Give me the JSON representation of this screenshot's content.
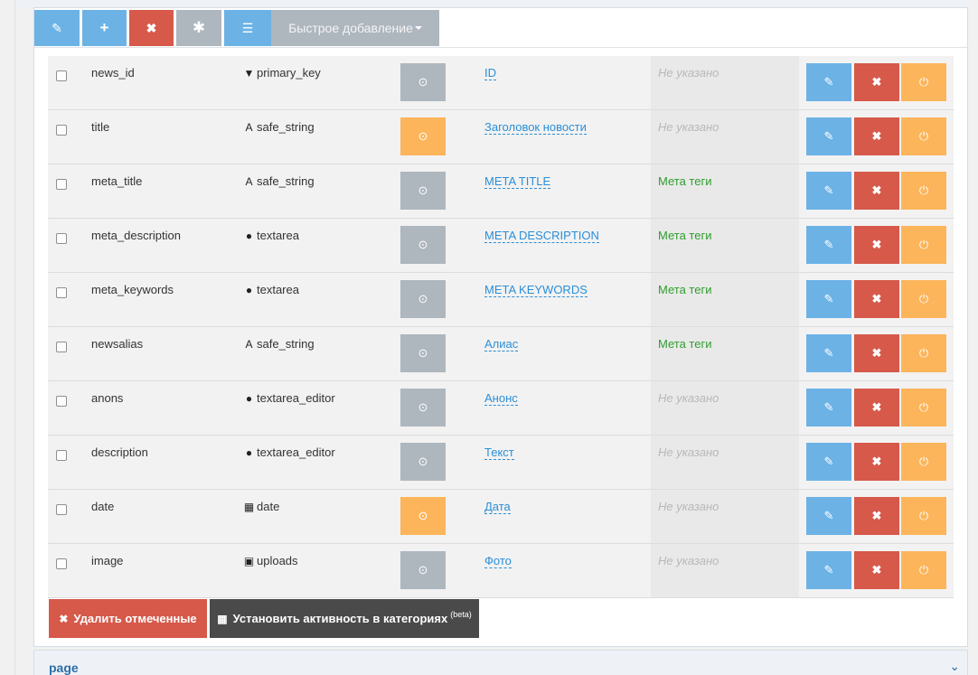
{
  "toolbar": {
    "edit_icon": "pencil-icon",
    "add_icon": "plus-icon",
    "delete_icon": "cross-icon",
    "star_icon": "asterisk-icon",
    "list_icon": "list-icon",
    "quick_add_label": "Быстрое добавление",
    "colors": {
      "primary": "#6cb2e5",
      "danger": "#d6594a",
      "muted": "#aeb6be",
      "warning": "#fcb55a",
      "dark": "#4a4a4a"
    }
  },
  "fields": [
    {
      "name": "news_id",
      "type_icon": "filter-icon",
      "type": "primary_key",
      "status": "on",
      "title": "ID",
      "category": "Не указано",
      "category_kind": "none"
    },
    {
      "name": "title",
      "type_icon": "font-icon",
      "type": "safe_string",
      "status": "warn",
      "title": "Заголовок новости",
      "category": "Не указано",
      "category_kind": "none"
    },
    {
      "name": "meta_title",
      "type_icon": "font-icon",
      "type": "safe_string",
      "status": "on",
      "title": "META TITLE",
      "category": "Мета теги",
      "category_kind": "meta"
    },
    {
      "name": "meta_description",
      "type_icon": "comment-icon",
      "type": "textarea",
      "status": "on",
      "title": "META DESCRIPTION",
      "category": "Мета теги",
      "category_kind": "meta"
    },
    {
      "name": "meta_keywords",
      "type_icon": "comment-icon",
      "type": "textarea",
      "status": "on",
      "title": "META KEYWORDS",
      "category": "Мета теги",
      "category_kind": "meta"
    },
    {
      "name": "newsalias",
      "type_icon": "font-icon",
      "type": "safe_string",
      "status": "on",
      "title": "Алиас",
      "category": "Мета теги",
      "category_kind": "meta"
    },
    {
      "name": "anons",
      "type_icon": "comment-icon",
      "type": "textarea_editor",
      "status": "on",
      "title": "Анонс",
      "category": "Не указано",
      "category_kind": "none"
    },
    {
      "name": "description",
      "type_icon": "comment-icon",
      "type": "textarea_editor",
      "status": "on",
      "title": "Текст",
      "category": "Не указано",
      "category_kind": "none"
    },
    {
      "name": "date",
      "type_icon": "calendar-icon",
      "type": "date",
      "status": "warn",
      "title": "Дата",
      "category": "Не указано",
      "category_kind": "none"
    },
    {
      "name": "image",
      "type_icon": "picture-icon",
      "type": "uploads",
      "status": "on",
      "title": "Фото",
      "category": "Не указано",
      "category_kind": "none"
    }
  ],
  "bottom": {
    "delete_selected_label": "Удалить отмеченные",
    "set_activity_label": "Установить активность в категориях",
    "set_activity_sup": "(beta)"
  },
  "page_panel": {
    "title": "page"
  }
}
